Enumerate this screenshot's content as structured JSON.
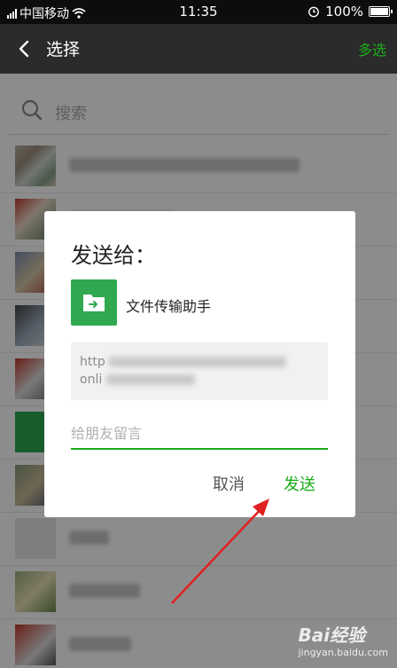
{
  "status_bar": {
    "carrier": "中国移动",
    "time": "11:35",
    "battery": "100%"
  },
  "header": {
    "title": "选择",
    "multi_select_label": "多选"
  },
  "search": {
    "placeholder": "搜索"
  },
  "dialog": {
    "title": "发送给：",
    "recipient": "文件传输助手",
    "preview_line1": "http",
    "preview_line2": "onli",
    "message_placeholder": "给朋友留言",
    "cancel_label": "取消",
    "send_label": "发送"
  },
  "watermark": {
    "brand": "Bai经验",
    "url": "jingyan.baidu.com"
  },
  "colors": {
    "accent_green": "#1aad19",
    "annotation_red": "#e02020"
  }
}
